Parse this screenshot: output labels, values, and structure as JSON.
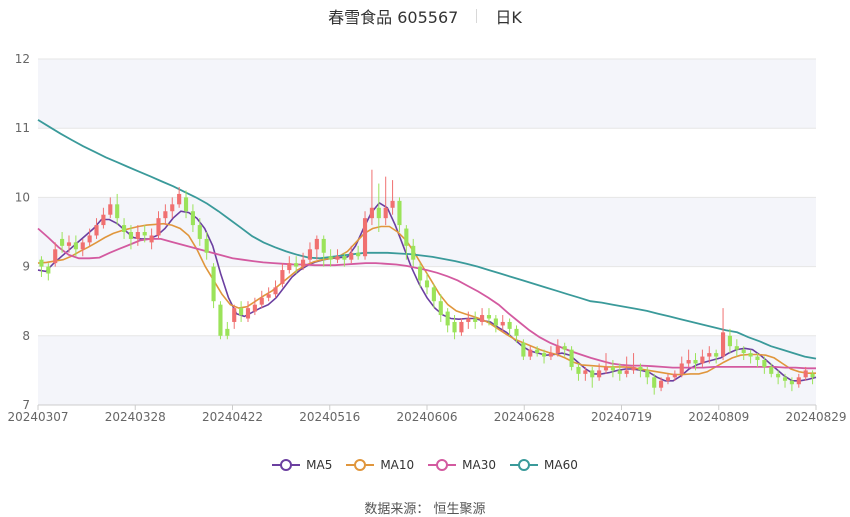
{
  "header": {
    "title": "春雪食品 605567",
    "period": "日K"
  },
  "legend": [
    {
      "name": "MA5",
      "color": "#6b3fa0"
    },
    {
      "name": "MA10",
      "color": "#e0963c"
    },
    {
      "name": "MA30",
      "color": "#d35aa0"
    },
    {
      "name": "MA60",
      "color": "#3a9a9a"
    }
  ],
  "source": "数据来源： 恒生聚源",
  "chart_data": {
    "type": "candlestick",
    "ylim": [
      7,
      12
    ],
    "yticks": [
      7,
      8,
      9,
      10,
      11,
      12
    ],
    "xticks": [
      "20240307",
      "20240328",
      "20240422",
      "20240516",
      "20240606",
      "20240628",
      "20240719",
      "20240809",
      "20240829"
    ],
    "colors": {
      "up": "#f07070",
      "down": "#9be35a"
    },
    "candles": [
      [
        9.1,
        9.0,
        9.15,
        8.85
      ],
      [
        9.0,
        8.9,
        9.05,
        8.8
      ],
      [
        9.05,
        9.25,
        9.35,
        9.0
      ],
      [
        9.4,
        9.3,
        9.5,
        9.2
      ],
      [
        9.3,
        9.35,
        9.45,
        9.2
      ],
      [
        9.35,
        9.25,
        9.45,
        9.15
      ],
      [
        9.25,
        9.35,
        9.4,
        9.15
      ],
      [
        9.35,
        9.45,
        9.55,
        9.3
      ],
      [
        9.45,
        9.6,
        9.7,
        9.4
      ],
      [
        9.6,
        9.75,
        9.85,
        9.55
      ],
      [
        9.75,
        9.9,
        10.0,
        9.7
      ],
      [
        9.9,
        9.7,
        10.05,
        9.6
      ],
      [
        9.6,
        9.5,
        9.7,
        9.4
      ],
      [
        9.5,
        9.4,
        9.6,
        9.25
      ],
      [
        9.4,
        9.5,
        9.6,
        9.3
      ],
      [
        9.5,
        9.45,
        9.6,
        9.35
      ],
      [
        9.35,
        9.45,
        9.55,
        9.25
      ],
      [
        9.45,
        9.7,
        9.8,
        9.4
      ],
      [
        9.7,
        9.8,
        9.9,
        9.6
      ],
      [
        9.8,
        9.9,
        10.0,
        9.7
      ],
      [
        9.9,
        10.05,
        10.15,
        9.85
      ],
      [
        10.0,
        9.8,
        10.1,
        9.7
      ],
      [
        9.8,
        9.6,
        9.9,
        9.5
      ],
      [
        9.6,
        9.4,
        9.7,
        9.3
      ],
      [
        9.4,
        9.2,
        9.5,
        9.1
      ],
      [
        9.0,
        8.5,
        9.05,
        8.4
      ],
      [
        8.45,
        8.0,
        8.5,
        7.95
      ],
      [
        8.1,
        8.0,
        8.2,
        7.95
      ],
      [
        8.2,
        8.4,
        8.45,
        8.1
      ],
      [
        8.4,
        8.3,
        8.5,
        8.2
      ],
      [
        8.25,
        8.4,
        8.5,
        8.2
      ],
      [
        8.35,
        8.45,
        8.55,
        8.3
      ],
      [
        8.45,
        8.55,
        8.65,
        8.4
      ],
      [
        8.55,
        8.6,
        8.7,
        8.5
      ],
      [
        8.6,
        8.7,
        8.8,
        8.55
      ],
      [
        8.75,
        8.95,
        9.05,
        8.7
      ],
      [
        8.95,
        9.05,
        9.15,
        8.9
      ],
      [
        9.05,
        9.0,
        9.15,
        8.9
      ],
      [
        9.0,
        9.1,
        9.2,
        8.95
      ],
      [
        9.1,
        9.25,
        9.35,
        9.05
      ],
      [
        9.25,
        9.4,
        9.45,
        9.1
      ],
      [
        9.4,
        9.2,
        9.45,
        9.0
      ],
      [
        9.15,
        9.1,
        9.25,
        9.0
      ],
      [
        9.1,
        9.15,
        9.25,
        9.05
      ],
      [
        9.15,
        9.1,
        9.2,
        9.0
      ],
      [
        9.1,
        9.2,
        9.3,
        9.05
      ],
      [
        9.2,
        9.15,
        9.3,
        9.1
      ],
      [
        9.15,
        9.7,
        9.8,
        9.1
      ],
      [
        9.7,
        9.85,
        10.4,
        9.6
      ],
      [
        9.85,
        9.7,
        10.2,
        9.5
      ],
      [
        9.7,
        9.85,
        10.3,
        9.6
      ],
      [
        9.85,
        9.95,
        10.25,
        9.75
      ],
      [
        9.95,
        9.6,
        10.0,
        9.5
      ],
      [
        9.55,
        9.3,
        9.6,
        9.1
      ],
      [
        9.3,
        9.1,
        9.4,
        9.0
      ],
      [
        9.0,
        8.8,
        9.05,
        8.7
      ],
      [
        8.8,
        8.7,
        8.9,
        8.6
      ],
      [
        8.7,
        8.5,
        8.75,
        8.4
      ],
      [
        8.5,
        8.3,
        8.6,
        8.2
      ],
      [
        8.35,
        8.15,
        8.4,
        8.05
      ],
      [
        8.2,
        8.05,
        8.3,
        7.95
      ],
      [
        8.05,
        8.2,
        8.25,
        8.0
      ],
      [
        8.2,
        8.25,
        8.35,
        8.1
      ],
      [
        8.25,
        8.2,
        8.35,
        8.1
      ],
      [
        8.2,
        8.3,
        8.4,
        8.15
      ],
      [
        8.3,
        8.25,
        8.4,
        8.15
      ],
      [
        8.25,
        8.15,
        8.3,
        8.05
      ],
      [
        8.15,
        8.2,
        8.3,
        8.05
      ],
      [
        8.2,
        8.1,
        8.25,
        8.0
      ],
      [
        8.1,
        8.0,
        8.15,
        7.9
      ],
      [
        7.9,
        7.7,
        7.95,
        7.65
      ],
      [
        7.7,
        7.8,
        7.85,
        7.65
      ],
      [
        7.8,
        7.75,
        7.85,
        7.7
      ],
      [
        7.75,
        7.7,
        7.8,
        7.6
      ],
      [
        7.7,
        7.75,
        7.85,
        7.65
      ],
      [
        7.75,
        7.85,
        7.95,
        7.7
      ],
      [
        7.85,
        7.8,
        7.9,
        7.7
      ],
      [
        7.8,
        7.55,
        7.85,
        7.5
      ],
      [
        7.55,
        7.45,
        7.6,
        7.35
      ],
      [
        7.45,
        7.5,
        7.55,
        7.35
      ],
      [
        7.5,
        7.4,
        7.55,
        7.25
      ],
      [
        7.4,
        7.5,
        7.6,
        7.35
      ],
      [
        7.5,
        7.55,
        7.75,
        7.45
      ],
      [
        7.55,
        7.5,
        7.65,
        7.4
      ],
      [
        7.5,
        7.45,
        7.6,
        7.35
      ],
      [
        7.45,
        7.5,
        7.7,
        7.4
      ],
      [
        7.5,
        7.55,
        7.75,
        7.45
      ],
      [
        7.55,
        7.5,
        7.6,
        7.4
      ],
      [
        7.5,
        7.4,
        7.55,
        7.3
      ],
      [
        7.4,
        7.25,
        7.45,
        7.15
      ],
      [
        7.25,
        7.35,
        7.4,
        7.2
      ],
      [
        7.35,
        7.4,
        7.45,
        7.3
      ],
      [
        7.4,
        7.45,
        7.5,
        7.35
      ],
      [
        7.45,
        7.6,
        7.7,
        7.4
      ],
      [
        7.6,
        7.65,
        7.8,
        7.55
      ],
      [
        7.65,
        7.6,
        7.75,
        7.5
      ],
      [
        7.6,
        7.7,
        7.8,
        7.55
      ],
      [
        7.7,
        7.75,
        7.85,
        7.6
      ],
      [
        7.75,
        7.7,
        7.8,
        7.6
      ],
      [
        7.7,
        8.05,
        8.4,
        7.65
      ],
      [
        8.0,
        7.85,
        8.1,
        7.75
      ],
      [
        7.85,
        7.8,
        7.95,
        7.7
      ],
      [
        7.8,
        7.75,
        7.85,
        7.65
      ],
      [
        7.75,
        7.7,
        7.8,
        7.6
      ],
      [
        7.7,
        7.65,
        7.75,
        7.55
      ],
      [
        7.65,
        7.55,
        7.7,
        7.45
      ],
      [
        7.55,
        7.45,
        7.6,
        7.4
      ],
      [
        7.45,
        7.4,
        7.5,
        7.3
      ],
      [
        7.4,
        7.35,
        7.45,
        7.25
      ],
      [
        7.35,
        7.3,
        7.4,
        7.2
      ],
      [
        7.3,
        7.4,
        7.45,
        7.25
      ],
      [
        7.4,
        7.5,
        7.55,
        7.35
      ],
      [
        7.45,
        7.4,
        7.5,
        7.3
      ]
    ],
    "series": [
      {
        "name": "MA5",
        "color": "#6b3fa0",
        "values": [
          8.95,
          8.93,
          9.05,
          9.15,
          9.25,
          9.35,
          9.45,
          9.55,
          9.68,
          9.68,
          9.62,
          9.52,
          9.42,
          9.4,
          9.4,
          9.45,
          9.55,
          9.7,
          9.8,
          9.78,
          9.7,
          9.55,
          9.3,
          8.9,
          8.55,
          8.32,
          8.28,
          8.34,
          8.4,
          8.45,
          8.55,
          8.7,
          8.85,
          8.95,
          9.02,
          9.07,
          9.1,
          9.12,
          9.13,
          9.14,
          9.3,
          9.55,
          9.78,
          9.92,
          9.85,
          9.6,
          9.3,
          9.0,
          8.75,
          8.55,
          8.4,
          8.3,
          8.25,
          8.24,
          8.25,
          8.25,
          8.22,
          8.2,
          8.12,
          8.05,
          7.95,
          7.85,
          7.78,
          7.75,
          7.72,
          7.73,
          7.75,
          7.72,
          7.62,
          7.52,
          7.45,
          7.45,
          7.47,
          7.5,
          7.52,
          7.52,
          7.5,
          7.47,
          7.4,
          7.35,
          7.35,
          7.42,
          7.52,
          7.58,
          7.62,
          7.65,
          7.68,
          7.75,
          7.8,
          7.82,
          7.8,
          7.72,
          7.62,
          7.52,
          7.42,
          7.35,
          7.35,
          7.37,
          7.4
        ]
      },
      {
        "name": "MA10",
        "color": "#e0963c",
        "values": [
          9.05,
          9.06,
          9.08,
          9.1,
          9.15,
          9.22,
          9.28,
          9.35,
          9.42,
          9.48,
          9.52,
          9.55,
          9.58,
          9.6,
          9.61,
          9.62,
          9.6,
          9.55,
          9.45,
          9.25,
          9.0,
          8.8,
          8.6,
          8.45,
          8.4,
          8.42,
          8.5,
          8.58,
          8.65,
          8.75,
          8.85,
          8.95,
          9.02,
          9.07,
          9.1,
          9.12,
          9.15,
          9.22,
          9.35,
          9.48,
          9.55,
          9.58,
          9.58,
          9.5,
          9.38,
          9.2,
          9.0,
          8.8,
          8.6,
          8.45,
          8.36,
          8.32,
          8.28,
          8.24,
          8.18,
          8.1,
          8.02,
          7.95,
          7.9,
          7.85,
          7.8,
          7.76,
          7.73,
          7.68,
          7.62,
          7.58,
          7.57,
          7.56,
          7.55,
          7.55,
          7.55,
          7.54,
          7.52,
          7.5,
          7.48,
          7.46,
          7.44,
          7.44,
          7.45,
          7.45,
          7.48,
          7.55,
          7.62,
          7.68,
          7.72,
          7.73,
          7.73,
          7.72,
          7.68,
          7.6,
          7.52,
          7.48,
          7.46,
          7.46
        ]
      },
      {
        "name": "MA30",
        "color": "#d35aa0",
        "values": [
          9.55,
          9.42,
          9.28,
          9.17,
          9.12,
          9.12,
          9.13,
          9.2,
          9.26,
          9.32,
          9.38,
          9.4,
          9.4,
          9.36,
          9.32,
          9.28,
          9.24,
          9.2,
          9.16,
          9.12,
          9.1,
          9.08,
          9.06,
          9.05,
          9.04,
          9.03,
          9.03,
          9.02,
          9.02,
          9.02,
          9.03,
          9.04,
          9.05,
          9.05,
          9.04,
          9.03,
          9.01,
          8.98,
          8.95,
          8.91,
          8.86,
          8.8,
          8.72,
          8.64,
          8.55,
          8.45,
          8.32,
          8.2,
          8.08,
          7.98,
          7.9,
          7.84,
          7.78,
          7.73,
          7.68,
          7.64,
          7.6,
          7.58,
          7.57,
          7.57,
          7.56,
          7.55,
          7.54,
          7.54,
          7.54,
          7.54,
          7.55,
          7.55,
          7.55,
          7.55,
          7.55,
          7.55,
          7.55,
          7.54,
          7.54,
          7.53,
          7.53
        ]
      },
      {
        "name": "MA60",
        "color": "#3a9a9a",
        "values": [
          11.12,
          11.02,
          10.92,
          10.83,
          10.74,
          10.66,
          10.58,
          10.51,
          10.44,
          10.37,
          10.3,
          10.23,
          10.16,
          10.08,
          10.0,
          9.91,
          9.8,
          9.68,
          9.56,
          9.44,
          9.35,
          9.28,
          9.22,
          9.17,
          9.13,
          9.12,
          9.14,
          9.16,
          9.18,
          9.2,
          9.2,
          9.2,
          9.19,
          9.18,
          9.16,
          9.14,
          9.11,
          9.08,
          9.04,
          9.0,
          8.95,
          8.9,
          8.85,
          8.8,
          8.75,
          8.7,
          8.65,
          8.6,
          8.55,
          8.5,
          8.48,
          8.45,
          8.42,
          8.39,
          8.36,
          8.32,
          8.28,
          8.24,
          8.2,
          8.16,
          8.12,
          8.08,
          8.05,
          7.98,
          7.92,
          7.85,
          7.8,
          7.75,
          7.7,
          7.67
        ]
      }
    ]
  }
}
